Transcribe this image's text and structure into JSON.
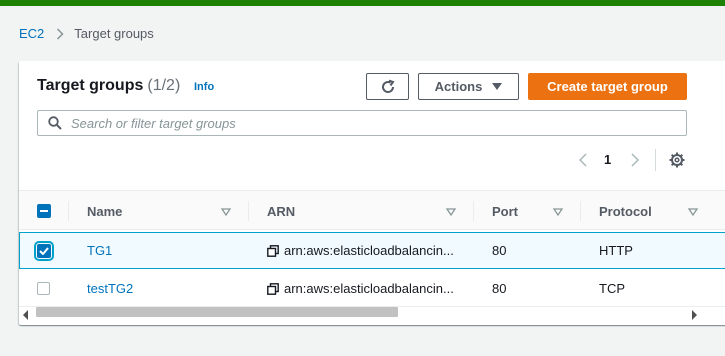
{
  "breadcrumb": {
    "root": "EC2",
    "current": "Target groups"
  },
  "header": {
    "title": "Target groups",
    "count": "(1/2)",
    "info": "Info"
  },
  "toolbar": {
    "refresh_icon": "refresh-icon",
    "actions_label": "Actions",
    "create_label": "Create target group"
  },
  "search": {
    "placeholder": "Search or filter target groups",
    "value": ""
  },
  "pagination": {
    "current_page": "1"
  },
  "table": {
    "columns": [
      "Name",
      "ARN",
      "Port",
      "Protocol"
    ],
    "rows": [
      {
        "name": "TG1",
        "arn": "arn:aws:elasticloadbalancin...",
        "port": "80",
        "protocol": "HTTP",
        "selected": true
      },
      {
        "name": "testTG2",
        "arn": "arn:aws:elasticloadbalancin...",
        "port": "80",
        "protocol": "TCP",
        "selected": false
      }
    ]
  },
  "colors": {
    "accent": "#ec7211",
    "link": "#0073bb",
    "top_bar": "#1d8102",
    "selected_row": "#f1faff",
    "selected_border": "#00a1c9"
  }
}
